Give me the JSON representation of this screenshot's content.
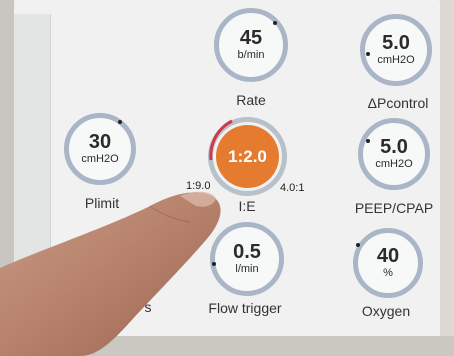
{
  "rate": {
    "value": "45",
    "unit": "b/min",
    "label": "Rate"
  },
  "dp_control": {
    "value": "5.0",
    "unit": "cmH2O",
    "label": "ΔPcontrol"
  },
  "plimit": {
    "value": "30",
    "unit": "cmH2O",
    "label": "Plimit"
  },
  "ie": {
    "value": "1:2.0",
    "min": "1:9.0",
    "max": "4.0:1",
    "label": "I:E"
  },
  "peep": {
    "value": "5.0",
    "unit": "cmH2O",
    "label": "PEEP/CPAP"
  },
  "flow_trigger": {
    "value": "0.5",
    "unit": "l/min",
    "label": "Flow trigger"
  },
  "oxygen": {
    "value": "40",
    "unit": "%",
    "label": "Oxygen"
  },
  "partial_label": "s",
  "colors": {
    "knob_ring": "#aab6c7",
    "active_knob": "#e47b2f",
    "screen": "#f0f1f0"
  }
}
